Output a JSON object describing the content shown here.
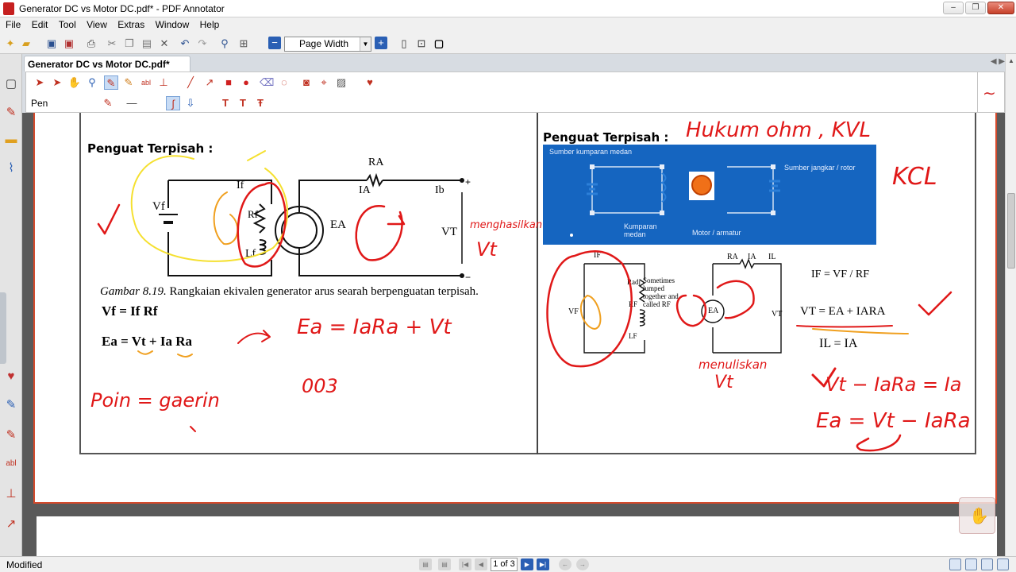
{
  "window": {
    "title": "Generator DC vs Motor DC.pdf* - PDF Annotator",
    "controls": [
      "–",
      "❐",
      "✕"
    ]
  },
  "menu": [
    "File",
    "Edit",
    "Tool",
    "View",
    "Extras",
    "Window",
    "Help"
  ],
  "toolbar": {
    "zoom_value": "Page Width"
  },
  "tabs": [
    {
      "label": "Generator DC vs Motor DC.pdf*"
    }
  ],
  "pen_toolbar": {
    "tool_label": "Pen"
  },
  "slide_left": {
    "title": "Penguat Terpisah :",
    "caption_prefix": "Gambar 8.19.",
    "caption_text": "Rangkaian ekivalen generator arus searah berpenguatan terpisah.",
    "eq1": "Vf = If Rf",
    "eq2": "Ea = Vt + Ia Ra",
    "circuit_labels": {
      "vf": "Vf",
      "if": "If",
      "rf": "Rf",
      "lf": "Lf",
      "ra": "RA",
      "ia": "IA",
      "ib": "Ib",
      "ea": "EA",
      "vt": "VT",
      "plus": "+",
      "minus": "−"
    }
  },
  "slide_right": {
    "title": "Penguat Terpisah :",
    "panel_labels": {
      "field_source": "Sumber kumparan medan",
      "armature_source": "Sumber jangkar / rotor",
      "field_coil": "Kumparan\nmedan",
      "motor": "Motor / armatur"
    },
    "circuit_labels": {
      "if": "IF",
      "ra": "RA",
      "ia": "IA",
      "il": "IL",
      "radj": "Radj",
      "rf": "RF",
      "lf": "LF",
      "vf": "VF",
      "ea": "EA",
      "vt": "VT",
      "note": "Sometimes lumped together and called RF"
    },
    "eq_if": "IF = VF / RF",
    "eq_vt": "VT = EA + IARA",
    "eq_il": "IL = IA"
  },
  "handwriting": {
    "left_1": "menghasilkan",
    "left_2": "Vt",
    "left_3": "Ea = IaRa + Vt",
    "left_4": "Poin = gaerin",
    "left_5": "003",
    "right_1": "Hukum ohm , KVL",
    "right_2": "KCL",
    "right_3": "menuliskan",
    "right_4": "Vt",
    "right_5": "Vt − IaRa = Ia",
    "right_6": "Ea = Vt − IaRa"
  },
  "status": {
    "text": "Modified",
    "page_indicator": "1 of 3"
  },
  "colors": {
    "annotation_red": "#e01818",
    "annotation_yellow": "#f5e030",
    "annotation_orange": "#f0a020",
    "panel_blue": "#1565c0",
    "page_border": "#d44a2c"
  }
}
